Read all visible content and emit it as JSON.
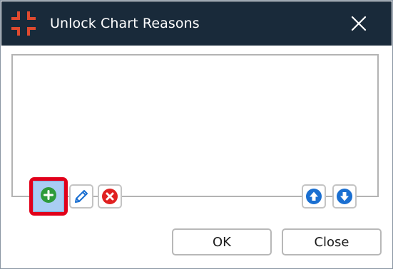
{
  "window": {
    "title": "Unlock Chart Reasons",
    "icon": "collapse-arrows-icon",
    "close_icon": "close-icon"
  },
  "colors": {
    "titlebar_bg": "#192a3a",
    "app_icon": "#e04a2f",
    "add_icon": "#2e9b3b",
    "delete_icon": "#e02121",
    "move_icon": "#1a6fd1",
    "edit_icon": "#1a6fd1",
    "highlight": "#e1001a",
    "selected_button_bg": "#a9cdf3"
  },
  "reasons_list": {
    "items": []
  },
  "toolbar": {
    "add": {
      "icon": "add-circle-icon"
    },
    "edit": {
      "icon": "pencil-icon"
    },
    "delete": {
      "icon": "delete-circle-icon"
    },
    "move_up": {
      "icon": "arrow-up-circle-icon"
    },
    "move_down": {
      "icon": "arrow-down-circle-icon"
    }
  },
  "footer": {
    "ok_label": "OK",
    "close_label": "Close"
  }
}
